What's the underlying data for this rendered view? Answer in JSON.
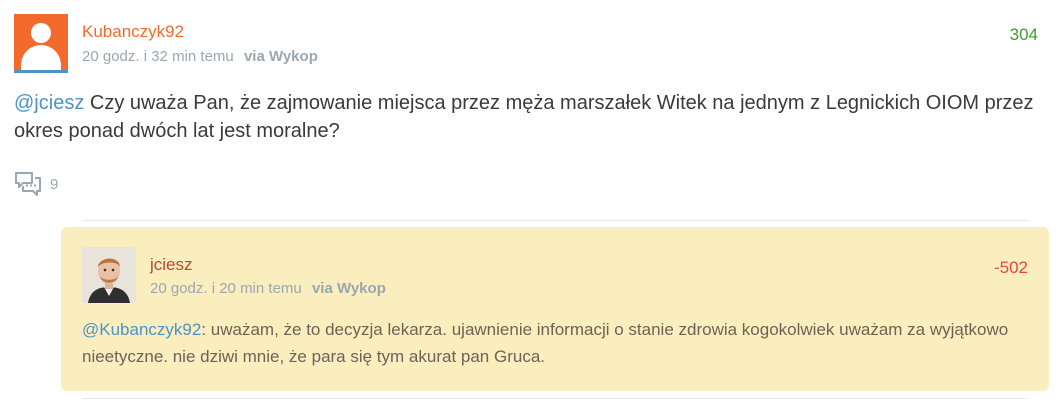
{
  "post": {
    "author": "Kubanczyk92",
    "time": "20 godz. i 32 min temu",
    "via": "via Wykop",
    "votes": "304",
    "mention": "@jciesz",
    "text": " Czy uważa Pan, że zajmowanie miejsca przez męża marszałek Witek na jednym z Legnickich OIOM przez okres ponad dwóch lat jest moralne?",
    "comments_count": "9",
    "avatar_icon": "default-user-icon",
    "comments_icon": "comments-icon"
  },
  "reply": {
    "author": "jciesz",
    "time": "20 godz. i 20 min temu",
    "via": "via Wykop",
    "votes": "-502",
    "mention": "@Kubanczyk92",
    "text": ": uważam, że to decyzja lekarza. ujawnienie informacji o stanie zdrowia kogokolwiek uważam za wyjątkowo nieetyczne. nie dziwi mnie, że para się tym akurat pan Gruca."
  },
  "colors": {
    "author_orange": "#f26a2c",
    "upvote_green": "#3a9c30",
    "downvote_red": "#e24a3a",
    "mention_blue": "#4a94c8",
    "reply_bg": "#faeebf",
    "meta_gray": "#9aa7b0"
  }
}
